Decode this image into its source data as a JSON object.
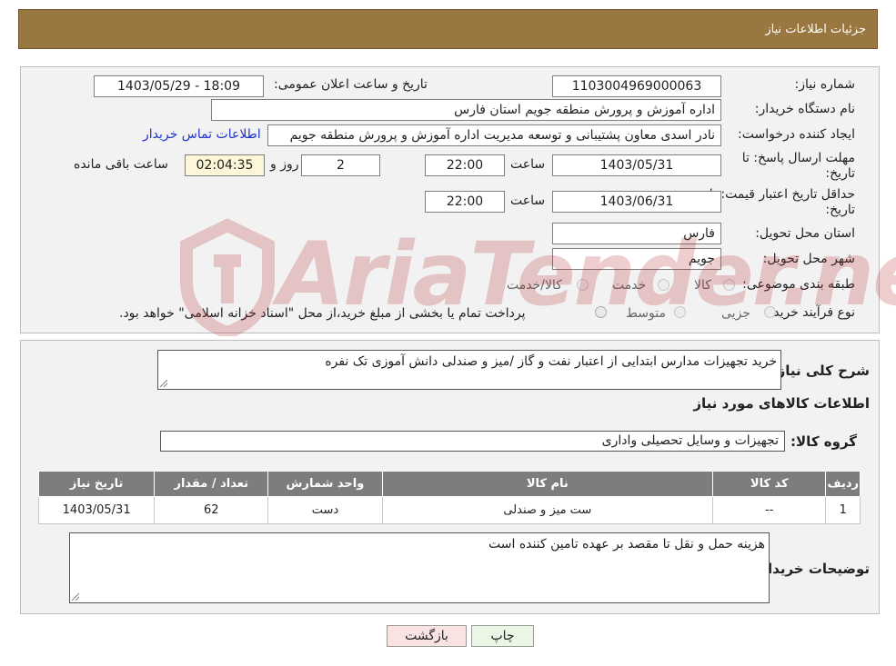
{
  "header": {
    "title": "جزئیات اطلاعات نیاز"
  },
  "form": {
    "need_number_label": "شماره نیاز:",
    "need_number": "1103004969000063",
    "announce_label": "تاریخ و ساعت اعلان عمومی:",
    "announce_value": "1403/05/29 - 18:09",
    "buyer_org_label": "نام دستگاه خریدار:",
    "buyer_org": "اداره آموزش و پرورش منطقه جویم استان فارس",
    "creator_label": "ایجاد کننده درخواست:",
    "creator": "نادر اسدی معاون پشتیبانی و توسعه مدیریت اداره آموزش و پرورش منطقه جویم",
    "contact_link": "اطلاعات تماس خریدار",
    "deadline_label": "مهلت ارسال پاسخ: تا تاریخ:",
    "deadline_date": "1403/05/31",
    "time_label": "ساعت",
    "deadline_time": "22:00",
    "days_value": "2",
    "days_label": "روز و",
    "remaining_time": "02:04:35",
    "remaining_label": "ساعت باقی مانده",
    "price_validity_label": "حداقل تاریخ اعتبار قیمت: تا تاریخ:",
    "price_validity_date": "1403/06/31",
    "price_validity_time": "22:00",
    "province_label": "استان محل تحویل:",
    "province": "فارس",
    "city_label": "شهر محل تحویل:",
    "city": "جویم",
    "category_label": "طبقه بندی موضوعی:",
    "category_options": [
      "کالا",
      "خدمت",
      "کالا/خدمت"
    ],
    "process_label": "نوع فرآیند خرید :",
    "process_options": [
      "جزیی",
      "متوسط"
    ],
    "process_note": "پرداخت تمام یا بخشی از مبلغ خرید،از محل \"اسناد خزانه اسلامی\" خواهد بود."
  },
  "details": {
    "summary_label": "شرح کلی نیاز:",
    "summary": "خرید تجهیزات مدارس ابتدایی از اعتبار نفت و گاز /میز و صندلی دانش آموزی تک نفره",
    "goods_info_title": "اطلاعات کالاهای مورد نیاز",
    "goods_group_label": "گروه کالا:",
    "goods_group": "تجهیزات و وسایل تحصیلی واداری",
    "table": {
      "headers": [
        "ردیف",
        "کد کالا",
        "نام کالا",
        "واحد شمارش",
        "تعداد / مقدار",
        "تاریخ نیاز"
      ],
      "rows": [
        [
          "1",
          "--",
          "ست میز و صندلی",
          "دست",
          "62",
          "1403/05/31"
        ]
      ]
    },
    "buyer_notes_label": "توضیحات خریدار:",
    "buyer_notes": "هزینه حمل و نقل تا مقصد بر عهده تامین کننده است"
  },
  "buttons": {
    "print": "چاپ",
    "back": "بازگشت"
  },
  "watermark": {
    "text": "AriaTender.neT"
  },
  "colors": {
    "header_bg": "#9a7740",
    "panel_bg": "#f2f2f2",
    "table_header_bg": "#7d7d7d",
    "link": "#1a33cc",
    "print_bg": "#eaf7e4",
    "back_bg": "#f9e2e2",
    "watermark": "#b02020"
  }
}
